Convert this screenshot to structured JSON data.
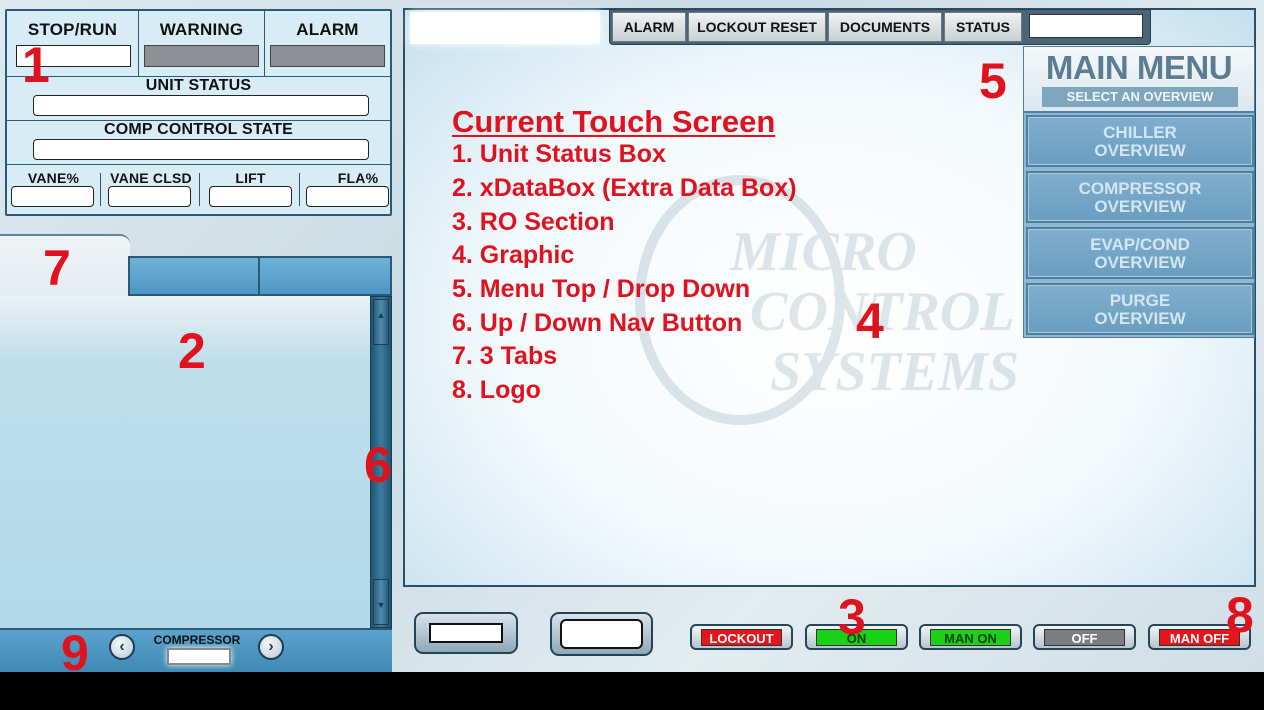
{
  "status_box": {
    "stop_run_label": "STOP/RUN",
    "warning_label": "WARNING",
    "alarm_label": "ALARM",
    "unit_status_label": "UNIT STATUS",
    "comp_control_state_label": "COMP CONTROL STATE",
    "bottom_labels": [
      "VANE%",
      "VANE CLSD",
      "LIFT",
      "FLA%"
    ]
  },
  "top_bar": {
    "buttons": [
      "ALARM",
      "LOCKOUT RESET",
      "DOCUMENTS",
      "STATUS"
    ]
  },
  "main_menu": {
    "title": "MAIN MENU",
    "subtitle": "SELECT AN OVERVIEW",
    "items": [
      {
        "line1": "CHILLER",
        "line2": "OVERVIEW"
      },
      {
        "line1": "COMPRESSOR",
        "line2": "OVERVIEW"
      },
      {
        "line1": "EVAP/COND",
        "line2": "OVERVIEW"
      },
      {
        "line1": "PURGE",
        "line2": "OVERVIEW"
      }
    ]
  },
  "notes": {
    "title": "Current Touch Screen",
    "lines": [
      "1. Unit Status Box",
      "2. xDataBox (Extra Data Box)",
      "3. RO Section",
      "4. Graphic",
      "5. Menu Top / Drop Down",
      "6. Up / Down Nav Button",
      "7. 3 Tabs",
      "8. Logo"
    ]
  },
  "watermark": {
    "line1": "MICRO",
    "line2": "CONTROL",
    "line3": "SYSTEMS"
  },
  "nav": {
    "label": "COMPRESSOR",
    "prev_symbol": "‹",
    "next_symbol": "›"
  },
  "ro_section": {
    "lockout": "LOCKOUT",
    "on": "ON",
    "man_on": "MAN ON",
    "off": "OFF",
    "man_off": "MAN OFF",
    "colors": {
      "lockout": "#e8141c",
      "on": "#19d119",
      "man_on": "#19d119",
      "off": "#7b7d80",
      "man_off": "#e8141c"
    }
  },
  "annotations": {
    "n1": "1",
    "n2": "2",
    "n3": "3",
    "n4": "4",
    "n5": "5",
    "n6": "6",
    "n7": "7",
    "n8": "8",
    "n9": "9"
  }
}
